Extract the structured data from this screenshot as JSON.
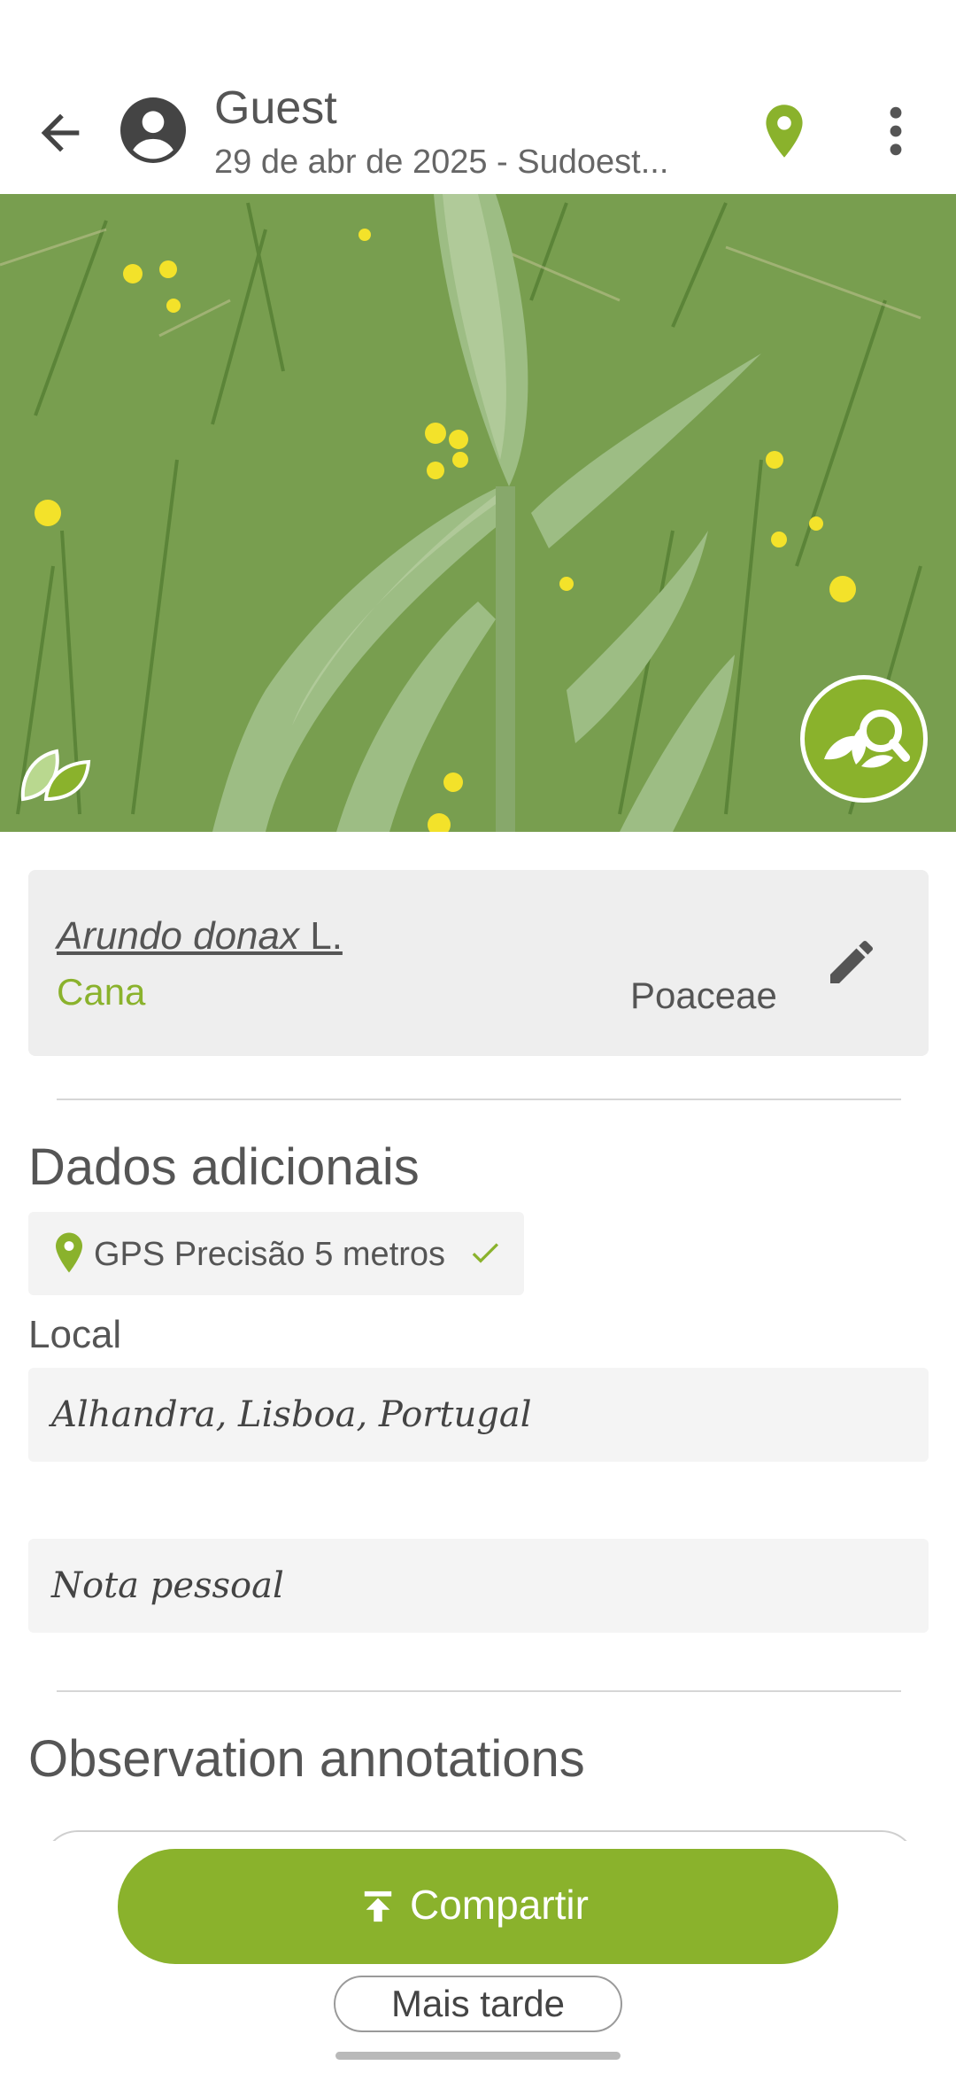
{
  "header": {
    "user_name": "Guest",
    "subtitle": "29 de abr de 2025 - Sudoest..."
  },
  "icons": {
    "back": "arrow-left-icon",
    "avatar": "account-circle-icon",
    "location": "map-pin-icon",
    "menu": "more-vert-icon",
    "leaf": "leaf-icon",
    "identify": "plant-search-icon",
    "edit": "pencil-icon",
    "check": "check-icon",
    "share": "upload-icon"
  },
  "species": {
    "genus_species": "Arundo donax",
    "author": " L.",
    "common_name": "Cana",
    "family": "Poaceae"
  },
  "additional": {
    "title": "Dados adicionais",
    "gps_text": "GPS Precisão 5 metros",
    "local_label": "Local",
    "local_value": "Alhandra, Lisboa, Portugal",
    "note_placeholder": "Nota pessoal"
  },
  "annotations": {
    "title": "Observation annotations"
  },
  "actions": {
    "share_label": "Compartir",
    "later_label": "Mais tarde"
  },
  "colors": {
    "accent": "#8ab22c",
    "text": "#555555",
    "card_bg": "#eeeeee"
  }
}
